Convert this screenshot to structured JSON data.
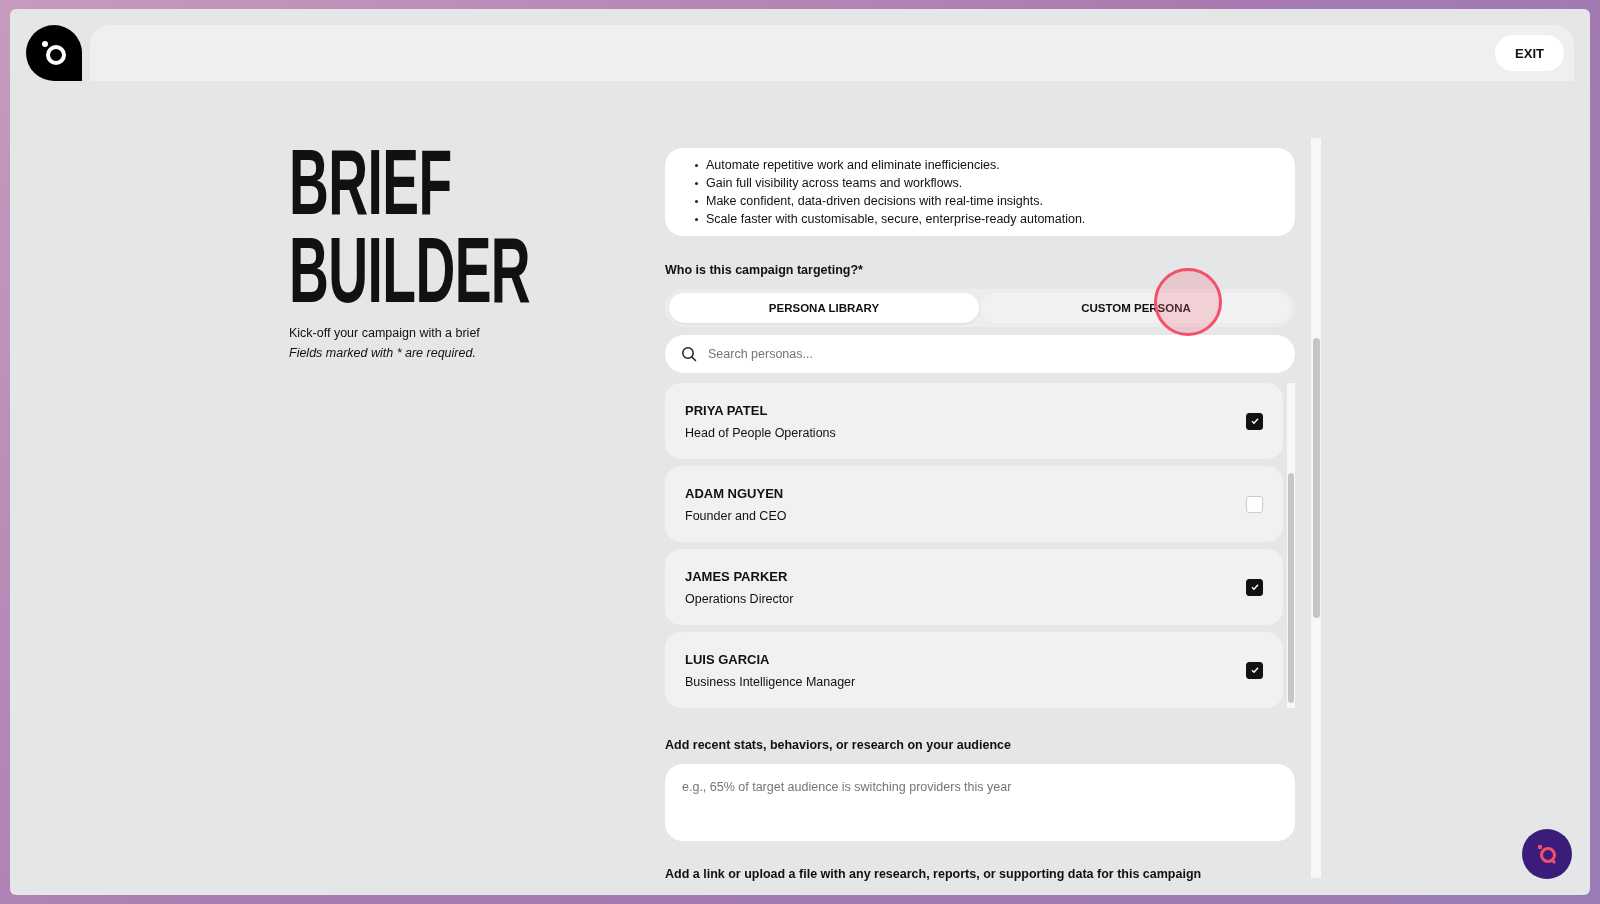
{
  "header": {
    "exit_button": "EXIT"
  },
  "intro": {
    "title_lines": [
      "BRIEF",
      "BUILDER"
    ],
    "subtitle": "Kick-off your campaign with a brief",
    "required_note": "Fields marked with * are required."
  },
  "benefits": [
    "Automate repetitive work and eliminate inefficiencies.",
    "Gain full visibility across teams and workflows.",
    "Make confident, data-driven decisions with real-time insights.",
    "Scale faster with customisable, secure, enterprise-ready automation."
  ],
  "targeting": {
    "label": "Who is this campaign targeting?*",
    "tabs": [
      {
        "label": "PERSONA LIBRARY",
        "selected": true
      },
      {
        "label": "CUSTOM PERSONA",
        "selected": false
      }
    ],
    "search": {
      "placeholder": "Search personas..."
    },
    "personas": [
      {
        "name": "PRIYA PATEL",
        "role": "Head of People Operations",
        "checked": true
      },
      {
        "name": "ADAM NGUYEN",
        "role": "Founder and CEO",
        "checked": false
      },
      {
        "name": "JAMES PARKER",
        "role": "Operations Director",
        "checked": true
      },
      {
        "name": "LUIS GARCIA",
        "role": "Business Intelligence Manager",
        "checked": true
      }
    ]
  },
  "research": {
    "label": "Add recent stats, behaviors, or research on your audience",
    "placeholder": "e.g., 65% of target audience is switching providers this year"
  },
  "upload": {
    "label": "Add a link or upload a file with any research, reports, or supporting data for this campaign"
  }
}
